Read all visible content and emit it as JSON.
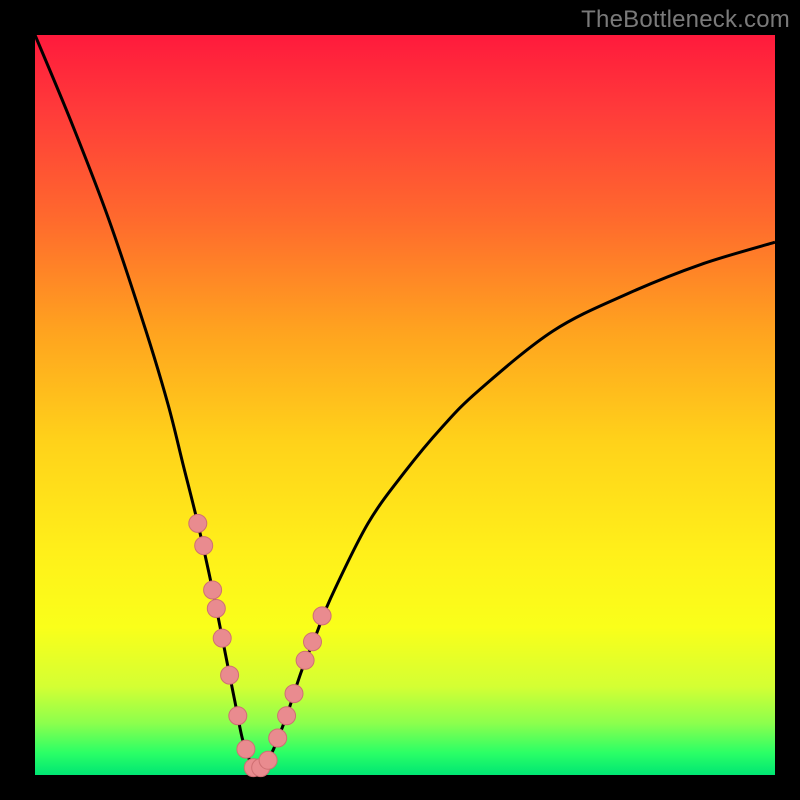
{
  "watermark": "TheBottleneck.com",
  "colors": {
    "frame": "#000000",
    "curve": "#000000",
    "marker_fill": "#e98b8f",
    "marker_stroke": "#cf6f73"
  },
  "chart_data": {
    "type": "line",
    "title": "",
    "xlabel": "",
    "ylabel": "",
    "xlim": [
      0,
      100
    ],
    "ylim": [
      0,
      100
    ],
    "grid": false,
    "series": [
      {
        "name": "bottleneck-curve",
        "x": [
          0,
          5,
          10,
          15,
          18,
          20,
          22,
          24,
          26,
          27,
          28,
          29,
          30,
          32,
          34,
          36,
          38,
          40,
          45,
          50,
          55,
          60,
          70,
          80,
          90,
          100
        ],
        "values": [
          100,
          88,
          75,
          60,
          50,
          42,
          34,
          25,
          15,
          10,
          5,
          2,
          0,
          3,
          8,
          14,
          19,
          24,
          34,
          41,
          47,
          52,
          60,
          65,
          69,
          72
        ]
      }
    ],
    "markers": {
      "name": "highlighted-points",
      "x": [
        22.0,
        22.8,
        24.0,
        24.5,
        25.3,
        26.3,
        27.4,
        28.5,
        29.5,
        30.5,
        31.5,
        32.8,
        34.0,
        35.0,
        36.5,
        37.5,
        38.8
      ],
      "y": [
        34.0,
        31.0,
        25.0,
        22.5,
        18.5,
        13.5,
        8.0,
        3.5,
        1.0,
        1.0,
        2.0,
        5.0,
        8.0,
        11.0,
        15.5,
        18.0,
        21.5
      ]
    }
  }
}
